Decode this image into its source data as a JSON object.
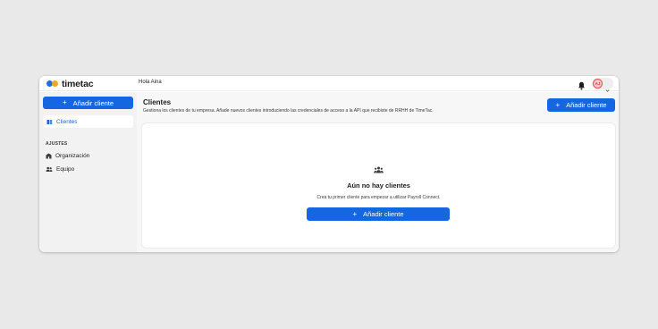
{
  "header": {
    "logo_text": "timetac",
    "greeting": "Hola Aina",
    "avatar_initials": "AJ",
    "icons": {
      "bell": "bell-icon",
      "chevron": "chevron-down-icon"
    }
  },
  "sidebar": {
    "add_button_label": "Añadir cliente",
    "active_item": {
      "label": "Clientes",
      "icon": "book-icon"
    },
    "section_title": "AJUSTES",
    "items": [
      {
        "label": "Organización",
        "icon": "building-icon"
      },
      {
        "label": "Equipo",
        "icon": "team-icon"
      }
    ]
  },
  "main": {
    "title": "Clientes",
    "description": "Gestiona los clientes de tu empresa. Añade nuevos clientes introduciendo las credenciales de acceso a la API que recibiste de RRHH de TimeTac.",
    "add_button_label": "Añadir cliente",
    "empty_state": {
      "icon": "people-icon",
      "title": "Aún no hay clientes",
      "description": "Crea tu primer cliente para empezar a utilizar Payroll Connect.",
      "button_label": "Añadir cliente"
    }
  },
  "colors": {
    "accent": "#1467e0",
    "logo_blue": "#1e6ee5",
    "logo_orange": "#f6a32a",
    "avatar_ring": "#e74c4c"
  }
}
